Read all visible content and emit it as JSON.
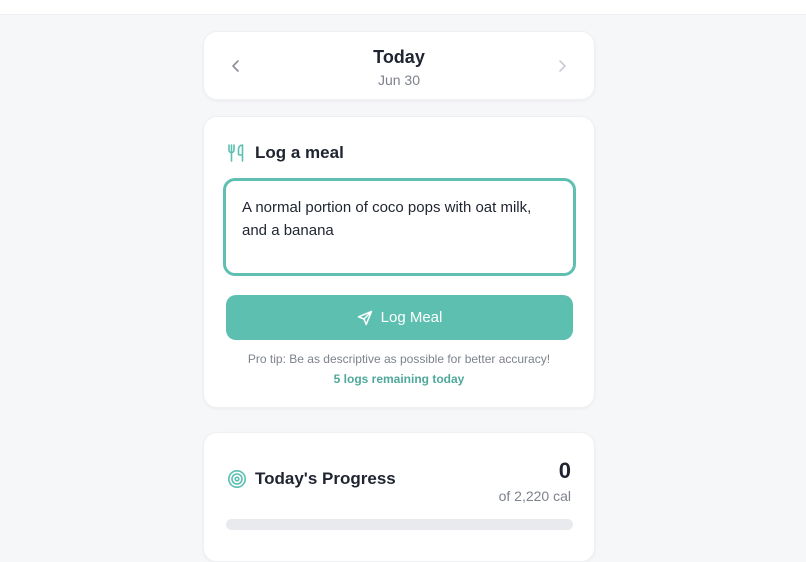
{
  "date_nav": {
    "title": "Today",
    "date": "Jun 30",
    "prev_icon": "chevron-left-icon",
    "next_icon": "chevron-right-icon"
  },
  "log_meal": {
    "title": "Log a meal",
    "icon": "utensils-icon",
    "input_value": "A normal portion of coco pops with oat milk, and a banana",
    "button_label": "Log Meal",
    "button_icon": "send-icon",
    "tip": "Pro tip: Be as descriptive as possible for better accuracy!",
    "remaining": "5 logs remaining today"
  },
  "progress": {
    "title": "Today's Progress",
    "icon": "target-icon",
    "value": "0",
    "goal_text": "of 2,220 cal",
    "fraction": 0
  },
  "colors": {
    "accent": "#5cbfb0",
    "accent_text": "#4fa89b",
    "background": "#f6f7f9",
    "track": "#e8eaed"
  }
}
